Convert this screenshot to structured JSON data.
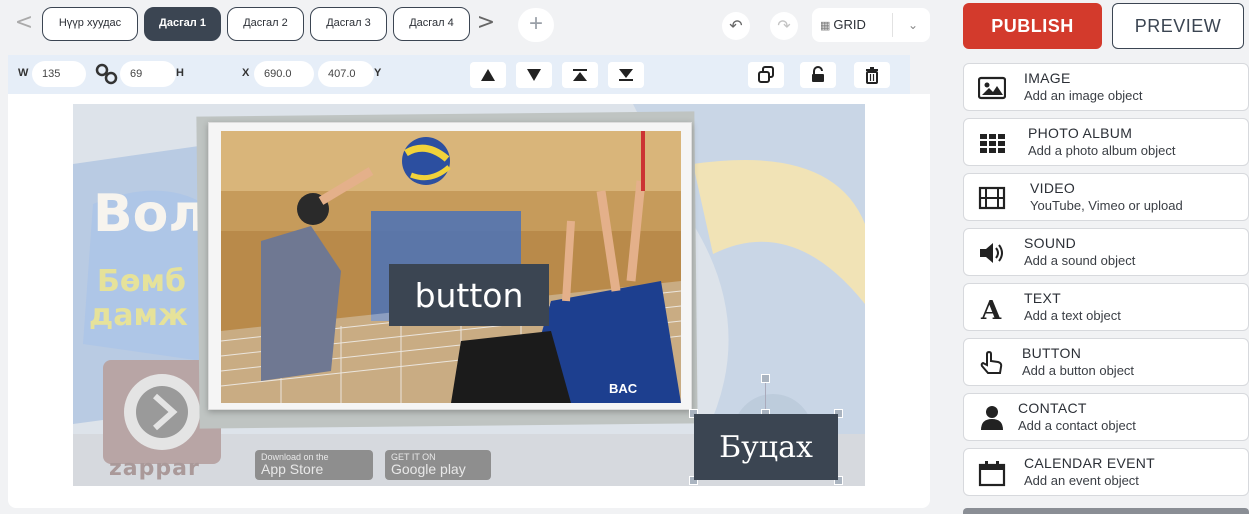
{
  "toolbar": {
    "prev_arrow": "<",
    "next_arrow": ">",
    "pages": [
      {
        "label": "Нүүр хуудас",
        "active": false
      },
      {
        "label": "Дасгал 1",
        "active": true
      },
      {
        "label": "Дасгал 2",
        "active": false
      },
      {
        "label": "Дасгал 3",
        "active": false
      },
      {
        "label": "Дасгал 4",
        "active": false
      }
    ],
    "add_page": "+",
    "grid_label": "GRID",
    "publish_label": "PUBLISH",
    "preview_label": "PREVIEW"
  },
  "properties": {
    "w_label": "W",
    "w_value": "135",
    "h_value": "69",
    "h_label": "H",
    "x_label": "X",
    "x_value": "690.0",
    "y_value": "407.0",
    "y_label": "Y"
  },
  "canvas": {
    "background_text_1": "Вол",
    "background_text_2": "Бөмб",
    "background_text_3": "дамж",
    "zapper_text": "zappar",
    "appstore_small": "Download on the",
    "appstore_big": "App Store",
    "googleplay_small": "GET IT ON",
    "googleplay_big": "Google play",
    "photo_button_label": "button",
    "selected_text": "Буцах",
    "photo_jersey_text": "BAC"
  },
  "objects": [
    {
      "title": "IMAGE",
      "subtitle": "Add an image object",
      "icon": "image-icon"
    },
    {
      "title": "PHOTO ALBUM",
      "subtitle": "Add a photo album object",
      "icon": "photo-album-icon"
    },
    {
      "title": "VIDEO",
      "subtitle": "YouTube, Vimeo or upload",
      "icon": "video-icon"
    },
    {
      "title": "SOUND",
      "subtitle": "Add a sound object",
      "icon": "sound-icon"
    },
    {
      "title": "TEXT",
      "subtitle": "Add a text object",
      "icon": "text-icon"
    },
    {
      "title": "BUTTON",
      "subtitle": "Add a button object",
      "icon": "button-icon"
    },
    {
      "title": "CONTACT",
      "subtitle": "Add a contact object",
      "icon": "contact-icon"
    },
    {
      "title": "CALENDAR EVENT",
      "subtitle": "Add an event object",
      "icon": "calendar-icon"
    }
  ],
  "colors": {
    "accent_dark": "#3b4552",
    "publish_red": "#d33a2c",
    "prop_bar_bg": "#e6eef8"
  }
}
